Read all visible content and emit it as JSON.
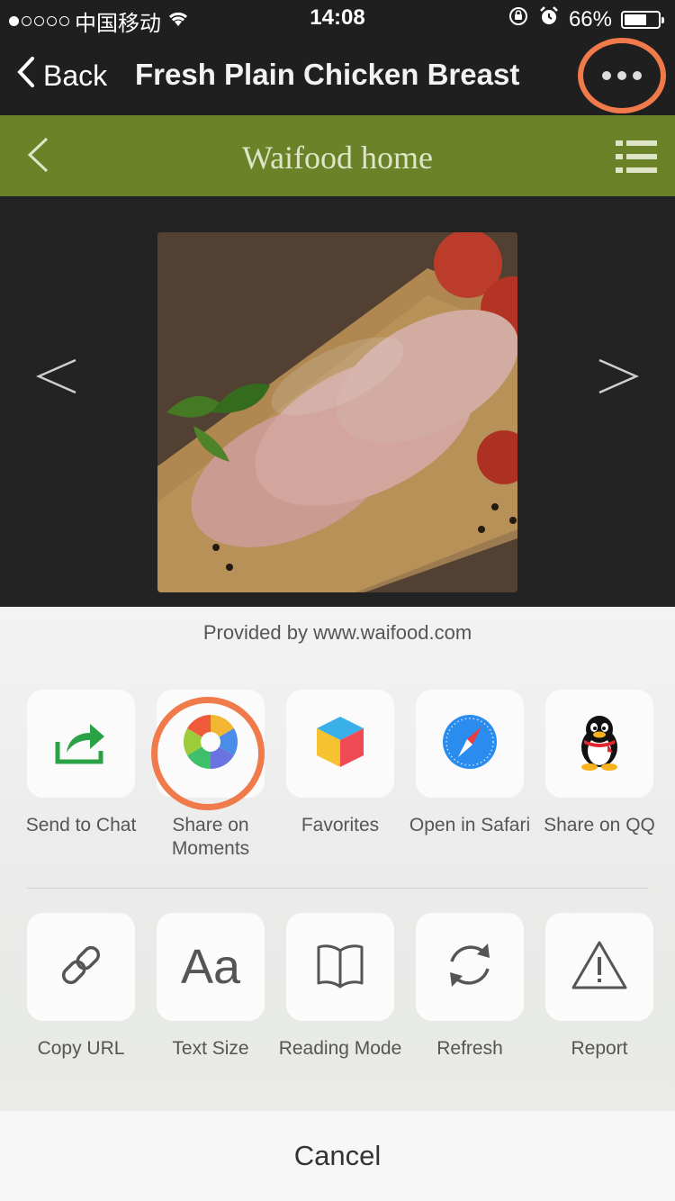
{
  "status_bar": {
    "carrier": "中国移动",
    "time": "14:08",
    "battery_percent": "66%",
    "battery_level": 0.66,
    "icons": [
      "signal-dots",
      "wifi-icon",
      "rotation-lock-icon",
      "alarm-icon",
      "battery-icon"
    ]
  },
  "nav": {
    "back_label": "Back",
    "title": "Fresh Plain Chicken Breast",
    "more_icon": "more-dots-icon"
  },
  "site": {
    "title": "Waifood home",
    "back_icon": "chevron-left-icon",
    "menu_icon": "list-menu-icon"
  },
  "gallery": {
    "prev_icon": "angle-left-icon",
    "next_icon": "angle-right-icon",
    "image": "chicken-breast-photo"
  },
  "sheet": {
    "provided_by": "Provided by www.waifood.com",
    "row1": [
      {
        "label": "Send to Chat",
        "icon": "share-arrow-icon"
      },
      {
        "label": "Share on Moments",
        "icon": "moments-aperture-icon"
      },
      {
        "label": "Favorites",
        "icon": "favorites-cube-icon"
      },
      {
        "label": "Open in Safari",
        "icon": "safari-compass-icon"
      },
      {
        "label": "Share on QQ",
        "icon": "qq-penguin-icon"
      }
    ],
    "row2": [
      {
        "label": "Copy URL",
        "icon": "link-icon"
      },
      {
        "label": "Text Size",
        "icon": "text-size-icon",
        "glyph": "Aa"
      },
      {
        "label": "Reading Mode",
        "icon": "book-icon"
      },
      {
        "label": "Refresh",
        "icon": "refresh-icon"
      },
      {
        "label": "Report",
        "icon": "warning-icon"
      }
    ],
    "cancel_label": "Cancel"
  },
  "colors": {
    "site_header": "#6b8229",
    "highlight": "#f07a4a",
    "send_green": "#2aa347"
  }
}
